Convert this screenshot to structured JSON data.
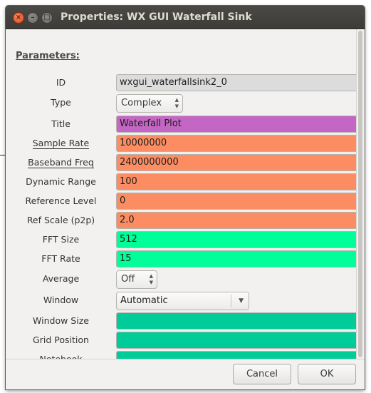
{
  "window": {
    "title": "Properties: WX GUI Waterfall Sink"
  },
  "params": {
    "heading": "Parameters:",
    "id": {
      "label": "ID",
      "value": "wxgui_waterfallsink2_0",
      "color": "#dcdcdc"
    },
    "type": {
      "label": "Type",
      "value": "Complex"
    },
    "title": {
      "label": "Title",
      "value": "Waterfall Plot",
      "color": "#c466c4"
    },
    "sample_rate": {
      "label": "Sample Rate",
      "value": "10000000",
      "color": "#fc8d62"
    },
    "baseband_freq": {
      "label": "Baseband Freq",
      "value": "2400000000",
      "color": "#fc8d62"
    },
    "dynamic_range": {
      "label": "Dynamic Range",
      "value": "100",
      "color": "#fc8d62"
    },
    "reference_level": {
      "label": "Reference Level",
      "value": "0",
      "color": "#fc8d62"
    },
    "ref_scale": {
      "label": "Ref Scale (p2p)",
      "value": "2.0",
      "color": "#fc8d62"
    },
    "fft_size": {
      "label": "FFT Size",
      "value": "512",
      "color": "#00ff99"
    },
    "fft_rate": {
      "label": "FFT Rate",
      "value": "15",
      "color": "#00ff99"
    },
    "average": {
      "label": "Average",
      "value": "Off"
    },
    "window": {
      "label": "Window",
      "value": "Automatic"
    },
    "window_size": {
      "label": "Window Size",
      "value": "",
      "color": "#00cc99"
    },
    "grid_position": {
      "label": "Grid Position",
      "value": "",
      "color": "#00cc99"
    },
    "notebook": {
      "label": "Notebook",
      "value": "",
      "color": "#00cc99"
    }
  },
  "buttons": {
    "cancel": "Cancel",
    "ok": "OK"
  }
}
